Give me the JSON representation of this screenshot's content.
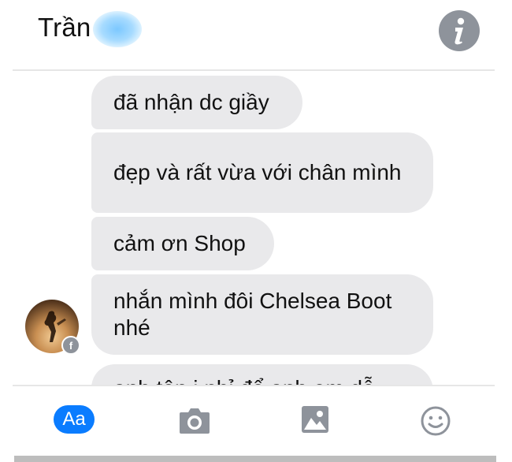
{
  "header": {
    "contact_name": "Trần",
    "info_icon": "info-icon"
  },
  "messages": [
    {
      "text": "đã nhận dc giầy"
    },
    {
      "text": "đẹp và rất vừa với chân mình"
    },
    {
      "text": "cảm ơn Shop"
    },
    {
      "text": "nhắn mình đôi Chelsea Boot nhé"
    },
    {
      "text": "anh tên j nhỉ để anh em dễ"
    }
  ],
  "avatar": {
    "badge": "f",
    "badge_icon": "facebook-icon"
  },
  "toolbar": {
    "aa_label": "Aa",
    "icons": [
      "camera-icon",
      "image-icon",
      "emoji-icon"
    ]
  },
  "colors": {
    "bubble": "#e9e9eb",
    "accent": "#0a7cff",
    "icon_gray": "#8e939b"
  }
}
